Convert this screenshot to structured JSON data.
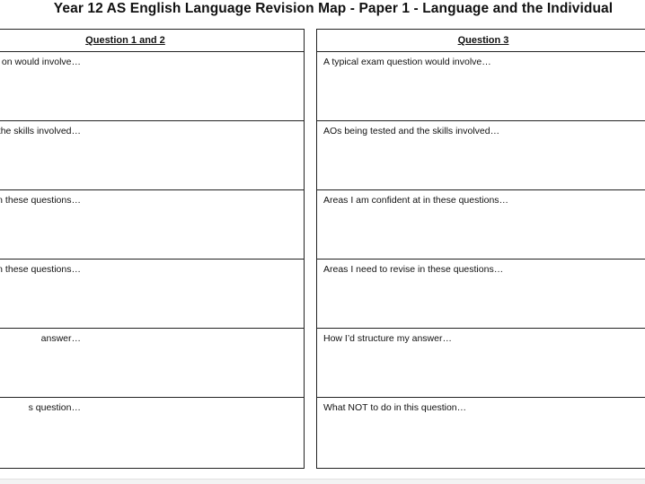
{
  "title": "Year 12 AS English Language Revision Map - Paper 1 - Language and the Individual",
  "left_table": {
    "header": "Question 1 and 2",
    "rows": [
      "on would involve…",
      "the skills involved…",
      "at in these questions…",
      "in these questions…",
      "answer…",
      "s question…"
    ]
  },
  "right_table": {
    "header": "Question 3",
    "rows": [
      "A typical exam question would involve…",
      "AOs being tested and the skills involved…",
      "Areas I am confident at in these questions…",
      "Areas I need to revise in these questions…",
      "How I’d structure my answer…",
      "What NOT to do in this question…"
    ]
  }
}
